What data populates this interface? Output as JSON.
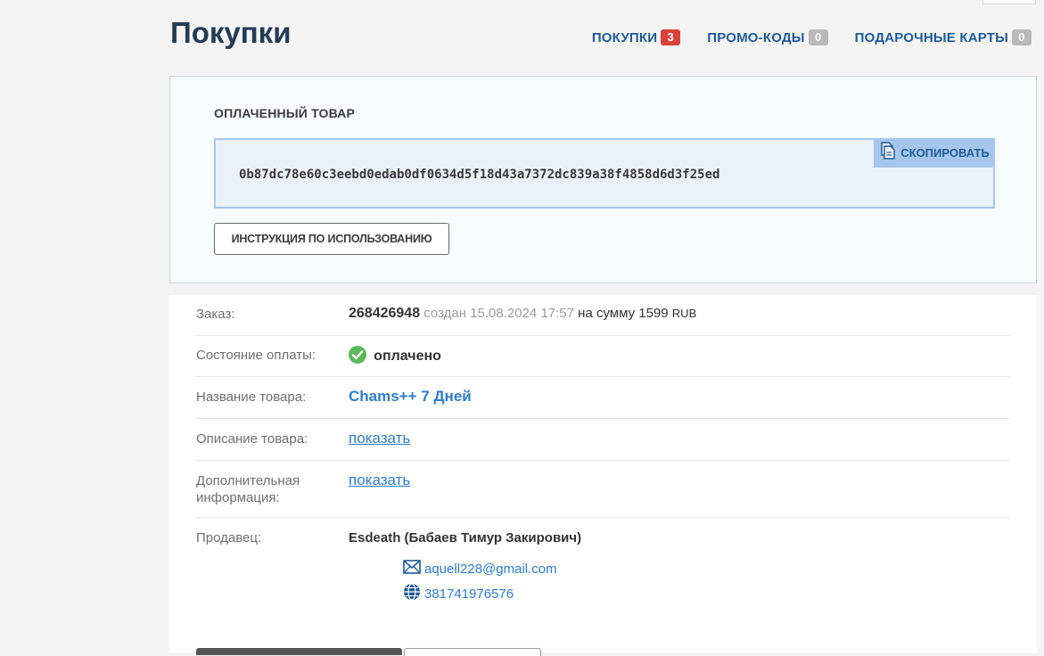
{
  "page": {
    "title": "Покупки"
  },
  "tabs": [
    {
      "label": "ПОКУПКИ",
      "count": "3"
    },
    {
      "label": "ПРОМО-КОДЫ",
      "count": "0"
    },
    {
      "label": "ПОДАРОЧНЫЕ КАРТЫ",
      "count": "0"
    }
  ],
  "product": {
    "heading": "ОПЛАЧЕННЫЙ ТОВАР",
    "code": "0b87dc78e60c3eebd0edab0df0634d5f18d43a7372dc839a38f4858d6d3f25ed",
    "copy_label": "СКОПИРОВАТЬ",
    "instructions_label": "ИНСТРУКЦИЯ ПО ИСПОЛЬЗОВАНИЮ"
  },
  "order": {
    "label": "Заказ:",
    "number": "268426948",
    "created_text": "создан 15.08.2024 17:57",
    "sum_text": "на сумму 1599",
    "currency": "RUB"
  },
  "payment": {
    "label": "Состояние оплаты:",
    "status": "оплачено"
  },
  "product_name": {
    "label": "Название товара:",
    "value": "Chams++ 7 Дней"
  },
  "description": {
    "label": "Описание товара:",
    "link": "показать"
  },
  "additional": {
    "label": "Дополнительная информация:",
    "link": "показать"
  },
  "seller": {
    "label": "Продавец:",
    "name": "Esdeath (Бабаев Тимур Закирович)",
    "email": "aquell228@gmail.com",
    "wmid": "381741976576"
  },
  "colors": {
    "accent": "#1e5a96",
    "link": "#2f7cc9",
    "badge_red": "#d9413a",
    "badge_grey": "#b9b9b9",
    "ok_green": "#5cb85c"
  }
}
